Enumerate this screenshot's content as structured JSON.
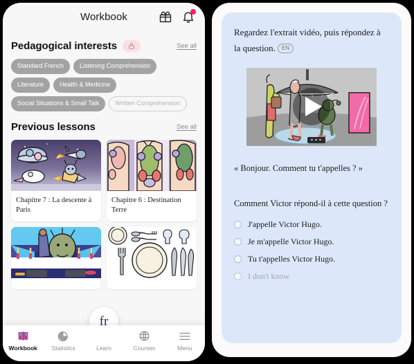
{
  "left_phone": {
    "header": {
      "title": "Workbook",
      "gift_icon": "gift-icon",
      "bell_icon": "bell-icon"
    },
    "interests_section": {
      "title": "Pedagogical interests",
      "lock_icon": "lock-icon",
      "see_all": "See all",
      "tags": [
        {
          "label": "Standard French",
          "style": "filled"
        },
        {
          "label": "Listening Comprehension",
          "style": "filled"
        },
        {
          "label": "Literature",
          "style": "filled"
        },
        {
          "label": "Health & Medicine",
          "style": "filled"
        },
        {
          "label": "Social Situations & Small Talk",
          "style": "filled"
        },
        {
          "label": "Written Comprehension",
          "style": "outline"
        }
      ]
    },
    "lessons_section": {
      "title": "Previous lessons",
      "see_all": "See all",
      "cards": [
        {
          "title": "Chapitre 7 : La descente à Paris",
          "thumb": "space-ufo-scene"
        },
        {
          "title": "Chapitre 6 : Destination Terre",
          "thumb": "airplane-cabin-aliens"
        },
        {
          "title": "",
          "thumb": "banquet-hall-scene"
        },
        {
          "title": "",
          "thumb": "table-place-setting"
        }
      ]
    },
    "bottom_nav": {
      "fab_label": "fr",
      "items": [
        {
          "label": "Workbook",
          "icon": "book-icon",
          "active": true
        },
        {
          "label": "Statistics",
          "icon": "pie-chart-icon",
          "active": false
        },
        {
          "label": "Learn",
          "icon": "",
          "active": false
        },
        {
          "label": "Courses",
          "icon": "globe-icon",
          "active": false
        },
        {
          "label": "Menu",
          "icon": "hamburger-icon",
          "active": false
        }
      ]
    }
  },
  "right_phone": {
    "exercise": {
      "prompt": "Regardez l'extrait vidéo, puis répondez à la question.",
      "language_badge": "EN",
      "video": {
        "play_icon": "play-icon"
      },
      "quote": "« Bonjour. Comment tu t'appelles ? »",
      "question": "Comment Victor répond-il à cette question ?",
      "choices": [
        {
          "label": "J'appelle Victor Hugo.",
          "muted": false
        },
        {
          "label": "Je m'appelle Victor Hugo.",
          "muted": false
        },
        {
          "label": "Tu t'appelles Victor Hugo.",
          "muted": false
        },
        {
          "label": "I don't know",
          "muted": true
        }
      ]
    }
  },
  "colors": {
    "page_background": "#000000",
    "phone_background": "#f7f7f7",
    "exercise_card": "#dce8f9",
    "notification_dot": "#ff1f57",
    "lock_pill": "#fbdfe2",
    "tag_fill": "#a3a3a3",
    "fab_text": "#2a2a62"
  }
}
